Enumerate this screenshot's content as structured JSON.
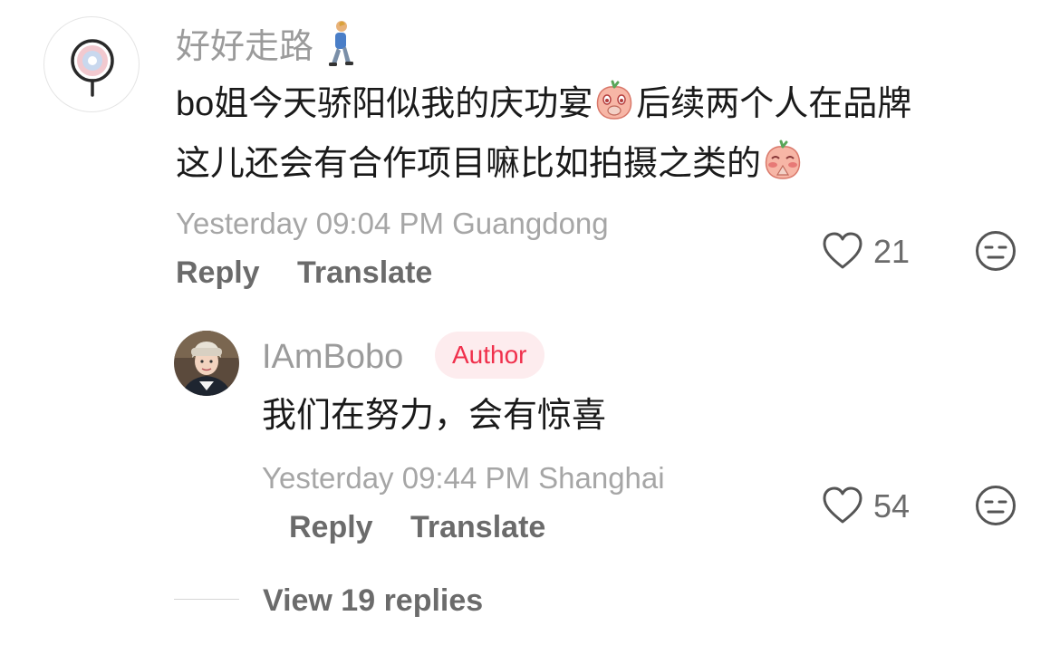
{
  "comment": {
    "username": "好好走路",
    "username_emoji_icon": "person-walking-icon",
    "text_parts": [
      "bo姐今天骄阳似我的庆功宴",
      "后续两个人在品牌",
      "这儿还会有合作项目嘛比如拍摄之类的"
    ],
    "inline_emojis": [
      "peach-shy-emoji-icon",
      "peach-pray-emoji-icon"
    ],
    "timestamp": "Yesterday 09:04 PM Guangdong",
    "reply_label": "Reply",
    "translate_label": "Translate",
    "like_count": "21",
    "colors": {
      "username": "#9b9b9b",
      "text": "#1a1a1a",
      "meta": "#a6a6a6"
    }
  },
  "reply": {
    "username": "IAmBobo",
    "badge": "Author",
    "text": "我们在努力，会有惊喜",
    "timestamp": "Yesterday 09:44 PM Shanghai",
    "reply_label": "Reply",
    "translate_label": "Translate",
    "like_count": "54",
    "colors": {
      "badge_bg": "#fdecee",
      "badge_text": "#f0304c"
    }
  },
  "view_replies": "View 19 replies"
}
